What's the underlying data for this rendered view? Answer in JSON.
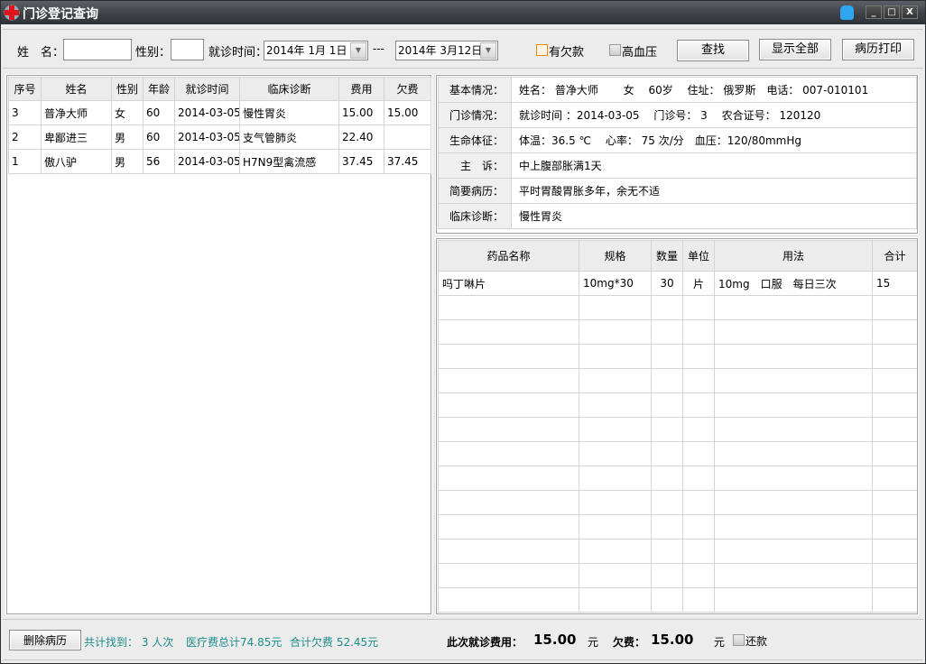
{
  "window": {
    "title": "门诊登记查询",
    "icons": {
      "logo": "medical-cross-icon",
      "skin": "shirt-icon"
    },
    "controls": {
      "minimize": "_",
      "maximize": "□",
      "close": "X"
    }
  },
  "search": {
    "name_label": "姓　名：",
    "name_value": "",
    "gender_label": "性别：",
    "gender_value": "",
    "date_label": "就诊时间：",
    "date_from": "2014年 1月 1日",
    "date_sep": "---",
    "date_to": "2014年 3月12日",
    "arrears_label": "有欠款",
    "arrears_checked": false,
    "hypertension_label": "高血压",
    "hypertension_checked": false,
    "find_button": "查找",
    "show_all_button": "显示全部",
    "print_button": "病历打印"
  },
  "patients": {
    "columns": [
      "序号",
      "姓名",
      "性别",
      "年龄",
      "就诊时间",
      "临床诊断",
      "费用",
      "欠费"
    ],
    "rows": [
      [
        "3",
        "普净大师",
        "女",
        "60",
        "2014-03-05",
        "慢性胃炎",
        "15.00",
        "15.00"
      ],
      [
        "2",
        "卑鄙进三",
        "男",
        "60",
        "2014-03-05",
        "支气管肺炎",
        "22.40",
        ""
      ],
      [
        "1",
        "傲八驴",
        "男",
        "56",
        "2014-03-05",
        "H7N9型禽流感",
        "37.45",
        "37.45"
      ]
    ]
  },
  "detail": [
    {
      "label": "基本情况：",
      "value": "姓名： 普净大师　　 女　 60岁　 住址： 俄罗斯　电话： 007-010101"
    },
    {
      "label": "门诊情况：",
      "value": "就诊时间 ：2014-03-05　 门诊号： 3　 农合证号： 120120"
    },
    {
      "label": "生命体征：",
      "value": "体温：36.5 ℃　 心率： 75 次/分　血压：120/80mmHg"
    },
    {
      "label": "主　诉：",
      "value": "中上腹部胀满1天"
    },
    {
      "label": "简要病历：",
      "value": "平时胃酸胃胀多年，余无不适"
    },
    {
      "label": "临床诊断：",
      "value": "慢性胃炎"
    }
  ],
  "drugs": {
    "columns": [
      "药品名称",
      "规格",
      "数量",
      "单位",
      "用法",
      "合计"
    ],
    "rows": [
      [
        "吗丁啉片",
        "10mg*30",
        "30",
        "片",
        "10mg　口服　每日三次",
        "15"
      ]
    ]
  },
  "footer": {
    "delete_button": "删除病历",
    "found": "共计找到： 3 人次",
    "total_fee": "医疗费总计74.85元",
    "total_arrears": "合计欠费 52.45元",
    "visit_fee_label": "此次就诊费用：",
    "visit_fee": "15.00",
    "yuan1": "元",
    "arrears_label": "欠费：",
    "arrears": "15.00",
    "yuan2": "元",
    "repay_label": "还款",
    "repay_checked": false
  }
}
